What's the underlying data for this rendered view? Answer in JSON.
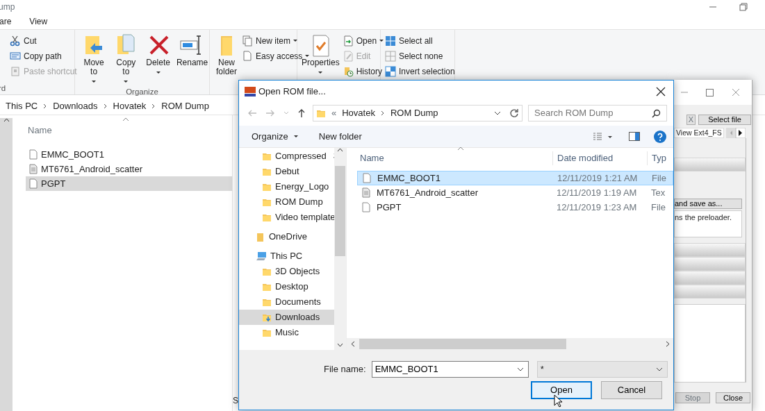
{
  "explorer": {
    "title": "ump",
    "tabs": [
      "are",
      "View"
    ],
    "ribbon": [
      {
        "label": "rd",
        "items": [
          {
            "kind": "small",
            "label": "Cut",
            "dropdown": false,
            "disabled": false
          },
          {
            "kind": "small",
            "label": "Copy path",
            "dropdown": false,
            "disabled": false
          },
          {
            "kind": "small",
            "label": "Paste shortcut",
            "dropdown": false,
            "disabled": true
          }
        ]
      },
      {
        "label": "Organize",
        "items": [
          {
            "kind": "large",
            "label": "Move to",
            "dropdown": true,
            "disabled": false
          },
          {
            "kind": "large",
            "label": "Copy to",
            "dropdown": true,
            "disabled": false
          },
          {
            "kind": "large",
            "label": "Delete",
            "dropdown": true,
            "disabled": false
          },
          {
            "kind": "large",
            "label": "Rename",
            "dropdown": false,
            "disabled": false
          }
        ]
      },
      {
        "items": [
          {
            "kind": "large",
            "label": "New folder",
            "dropdown": false,
            "disabled": false
          },
          {
            "kind": "small",
            "label": "New item",
            "dropdown": true,
            "disabled": false
          },
          {
            "kind": "small",
            "label": "Easy access",
            "dropdown": true,
            "disabled": false
          }
        ]
      },
      {
        "items": [
          {
            "kind": "large",
            "label": "Properties",
            "dropdown": true,
            "disabled": false
          },
          {
            "kind": "small",
            "label": "Open",
            "dropdown": true,
            "disabled": false
          },
          {
            "kind": "small",
            "label": "Edit",
            "dropdown": false,
            "disabled": true
          },
          {
            "kind": "small",
            "label": "History",
            "dropdown": false,
            "disabled": false
          }
        ]
      },
      {
        "items": [
          {
            "kind": "small",
            "label": "Select all",
            "dropdown": false,
            "disabled": false
          },
          {
            "kind": "small",
            "label": "Select none",
            "dropdown": false,
            "disabled": false
          },
          {
            "kind": "small",
            "label": "Invert selection",
            "dropdown": false,
            "disabled": false
          }
        ]
      }
    ],
    "breadcrumb": [
      "This PC",
      "Downloads",
      "Hovatek",
      "ROM Dump"
    ],
    "column_header": "Name",
    "files": [
      {
        "name": "EMMC_BOOT1",
        "kind": "file",
        "selected": false
      },
      {
        "name": "MT6761_Android_scatter",
        "kind": "text",
        "selected": false
      },
      {
        "name": "PGPT",
        "kind": "file",
        "selected": true
      }
    ],
    "status_bar": "S"
  },
  "tool_window": {
    "clear_button": "X",
    "select_file_button": "Select file",
    "tab": "View Ext4_FS",
    "save_button": "and save as...",
    "description": "ns the preloader.",
    "buttons": [
      {
        "label": "Stop",
        "disabled": true
      },
      {
        "label": "Close",
        "disabled": false
      }
    ]
  },
  "dialog": {
    "title": "Open ROM file...",
    "overflow_mark": "«",
    "breadcrumb": [
      "Hovatek",
      "ROM Dump"
    ],
    "search_placeholder": "Search ROM Dump",
    "toolbar": {
      "organize": "Organize",
      "new_folder": "New folder"
    },
    "nav_pane": {
      "quick_access": [
        {
          "label": "Compressed",
          "pinned": true,
          "selected": false
        },
        {
          "label": "Debut",
          "pinned": false,
          "selected": false
        },
        {
          "label": "Energy_Logo",
          "pinned": false,
          "selected": false
        },
        {
          "label": "ROM Dump",
          "pinned": false,
          "selected": false
        },
        {
          "label": "Video template",
          "pinned": false,
          "selected": false
        }
      ],
      "locations": [
        {
          "label": "OneDrive",
          "kind": "cloud",
          "selected": false
        },
        {
          "label": "This PC",
          "kind": "computer",
          "selected": false,
          "children": [
            {
              "label": "3D Objects",
              "kind": "folder",
              "selected": false
            },
            {
              "label": "Desktop",
              "kind": "folder",
              "selected": false
            },
            {
              "label": "Documents",
              "kind": "folder",
              "selected": false
            },
            {
              "label": "Downloads",
              "kind": "download",
              "selected": true
            },
            {
              "label": "Music",
              "kind": "folder",
              "selected": false
            }
          ]
        }
      ]
    },
    "columns": [
      "Name",
      "Date modified",
      "Typ"
    ],
    "files": [
      {
        "name": "EMMC_BOOT1",
        "date": "12/11/2019 1:21 AM",
        "type": "File",
        "kind": "file",
        "selected": true
      },
      {
        "name": "MT6761_Android_scatter",
        "date": "12/11/2019 1:19 AM",
        "type": "Tex",
        "kind": "text",
        "selected": false
      },
      {
        "name": "PGPT",
        "date": "12/11/2019 1:23 AM",
        "type": "File",
        "kind": "file",
        "selected": false
      }
    ],
    "file_name_label": "File name:",
    "file_name": "EMMC_BOOT1",
    "filter": "*",
    "buttons": [
      {
        "label": "Open",
        "default": true
      },
      {
        "label": "Cancel",
        "default": false
      }
    ]
  }
}
